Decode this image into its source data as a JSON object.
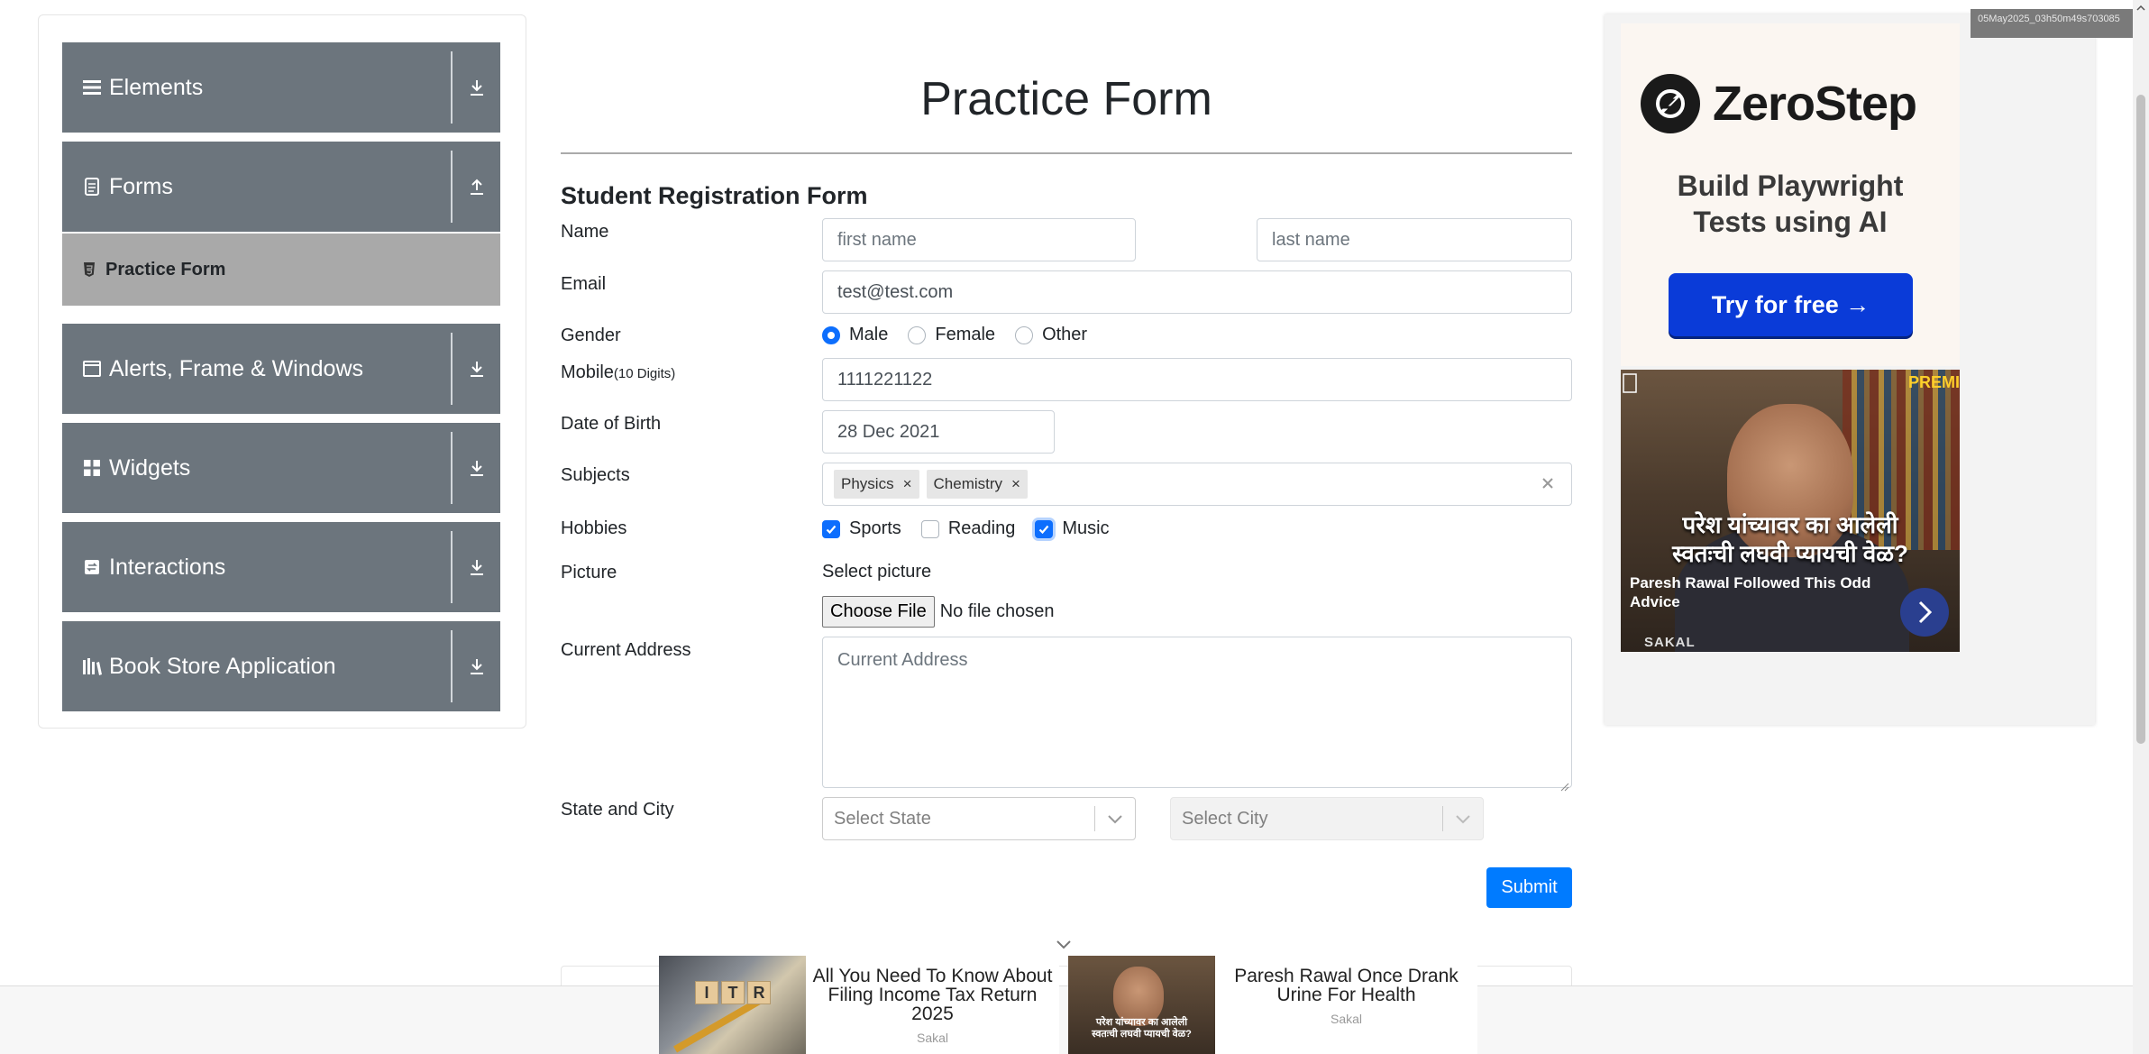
{
  "sidebar": {
    "groups": [
      {
        "label": "Elements",
        "icon": "hamburger-icon",
        "arrow": "download-arrow-icon"
      },
      {
        "label": "Forms",
        "icon": "document-icon",
        "arrow": "upload-arrow-icon"
      },
      {
        "label": "Alerts, Frame & Windows",
        "icon": "window-icon",
        "arrow": "download-arrow-icon"
      },
      {
        "label": "Widgets",
        "icon": "widgets-icon",
        "arrow": "download-arrow-icon"
      },
      {
        "label": "Interactions",
        "icon": "interactions-icon",
        "arrow": "download-arrow-icon"
      },
      {
        "label": "Book Store Application",
        "icon": "books-icon",
        "arrow": "download-arrow-icon"
      }
    ],
    "active_item": {
      "label": "Practice Form",
      "icon": "html5-icon"
    }
  },
  "main": {
    "title": "Practice Form",
    "form_heading": "Student Registration Form",
    "labels": {
      "name": "Name",
      "email": "Email",
      "gender": "Gender",
      "mobile": "Mobile",
      "mobile_hint": "(10 Digits)",
      "dob": "Date of Birth",
      "subjects": "Subjects",
      "hobbies": "Hobbies",
      "picture": "Picture",
      "address": "Current Address",
      "state_city": "State and City"
    },
    "fields": {
      "first_name": {
        "value": "first name"
      },
      "last_name": {
        "value": "last name"
      },
      "email": {
        "value": "test@test.com"
      },
      "mobile": {
        "value": "1111221122"
      },
      "dob": {
        "value": "28 Dec 2021"
      },
      "address": {
        "placeholder": "Current Address"
      }
    },
    "gender_options": [
      {
        "label": "Male",
        "checked": true
      },
      {
        "label": "Female",
        "checked": false
      },
      {
        "label": "Other",
        "checked": false
      }
    ],
    "subjects": [
      "Physics",
      "Chemistry"
    ],
    "chip_remove": "×",
    "hobbies": [
      {
        "label": "Sports",
        "checked": true
      },
      {
        "label": "Reading",
        "checked": false
      },
      {
        "label": "Music",
        "checked": true
      }
    ],
    "picture": {
      "select_label": "Select picture",
      "button": "Choose File",
      "status": "No file chosen"
    },
    "state_placeholder": "Select State",
    "city_placeholder": "Select City",
    "submit": "Submit"
  },
  "ad_right": {
    "brand": "ZeroStep",
    "tagline_1": "Build Playwright",
    "tagline_2": "Tests using AI",
    "cta": "Try for free →",
    "news_headline_1": "परेश यांच्यावर का आलेली",
    "news_headline_2": "स्वतःची लघवी प्यायची वेळ?",
    "news_caption": "Paresh Rawal Followed This Odd Advice",
    "news_source": "SAKAL",
    "news_badge": "PREMI"
  },
  "stamp": "05May2025_03h50m49s703085",
  "bottom_ads": [
    {
      "title": "All You Need To Know About Filing Income Tax Return 2025",
      "source": "Sakal",
      "thumb_text": "ITR"
    },
    {
      "title": "Paresh Rawal Once Drank Urine For Health",
      "source": "Sakal"
    }
  ],
  "colors": {
    "sidebar_group": "#6c757d",
    "sidebar_active": "#a9a9a9",
    "primary": "#007bff",
    "zerostep_button": "#0a3bd8"
  }
}
